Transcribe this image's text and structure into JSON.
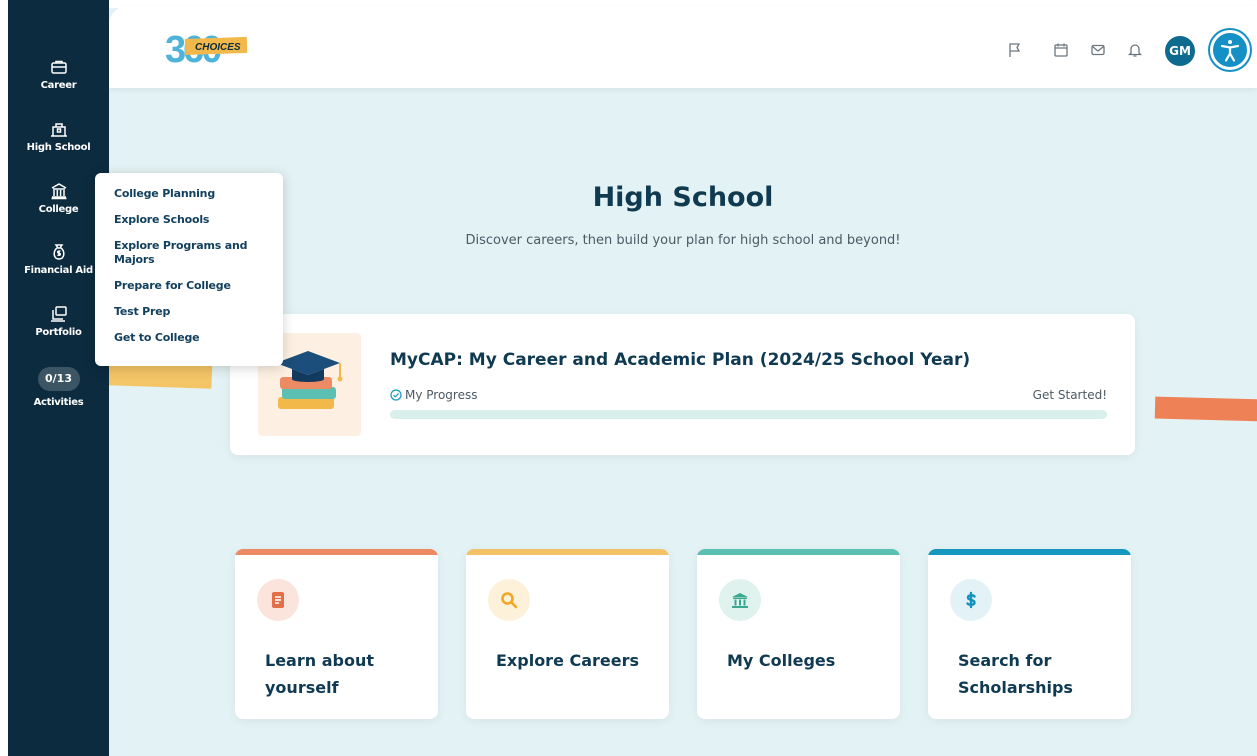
{
  "sidebar": {
    "items": [
      {
        "label": "Career",
        "icon": "briefcase-icon"
      },
      {
        "label": "High School",
        "icon": "school-building-icon"
      },
      {
        "label": "College",
        "icon": "college-building-icon"
      },
      {
        "label": "Financial Aid",
        "icon": "money-bag-icon"
      },
      {
        "label": "Portfolio",
        "icon": "portfolio-icon"
      }
    ],
    "activities": {
      "count": "0/13",
      "label": "Activities"
    }
  },
  "flyout": {
    "items": [
      "College Planning",
      "Explore Schools",
      "Explore Programs and Majors",
      "Prepare for College",
      "Test Prep",
      "Get to College"
    ]
  },
  "header": {
    "logo_text": "CHOICES",
    "logo_number": "360",
    "icons": [
      "flag-icon",
      "calendar-icon",
      "mail-icon",
      "bell-icon"
    ],
    "avatar_initials": "GM",
    "accessibility_icon": "accessibility-icon"
  },
  "main": {
    "title": "High School",
    "subtitle": "Discover careers, then build your plan for high school and beyond!",
    "mycap": {
      "title": "MyCAP: My Career and Academic Plan (2024/25 School Year)",
      "progress_label": "My Progress",
      "status": "Get Started!",
      "progress_fraction": 0
    },
    "cards": [
      {
        "title": "Learn about yourself",
        "icon": "book-icon",
        "accent": "#ec8a64"
      },
      {
        "title": "Explore Careers",
        "icon": "search-icon",
        "accent": "#f3c266"
      },
      {
        "title": "My Colleges",
        "icon": "college-icon",
        "accent": "#5bbfb1"
      },
      {
        "title": "Search for Scholarships",
        "icon": "dollar-icon",
        "accent": "#1597bf"
      }
    ]
  },
  "colors": {
    "sidebar": "#0c2b3e",
    "background": "#e3f2f4",
    "title": "#103a4f",
    "accessibility": "#1590c6"
  }
}
